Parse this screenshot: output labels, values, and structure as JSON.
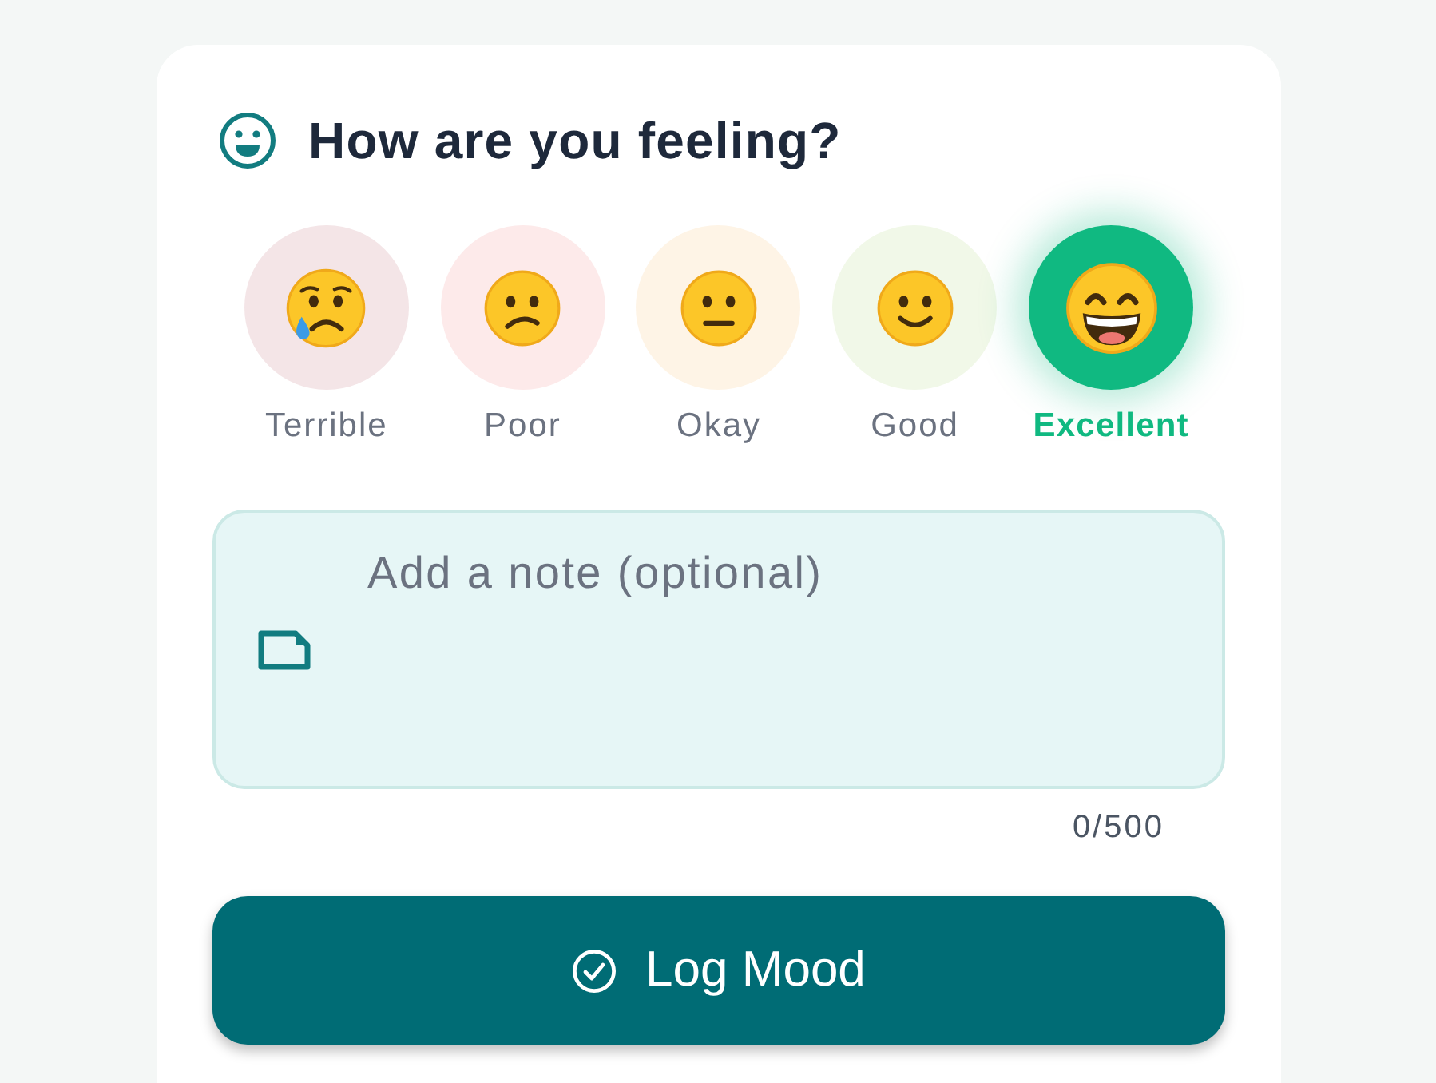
{
  "header": {
    "title": "How are you feeling?"
  },
  "moods": [
    {
      "kind": "terrible",
      "label": "Terrible",
      "color": "#f4e5e7",
      "selected": false
    },
    {
      "kind": "poor",
      "label": "Poor",
      "color": "#fdeaea",
      "selected": false
    },
    {
      "kind": "okay",
      "label": "Okay",
      "color": "#fef4e6",
      "selected": false
    },
    {
      "kind": "good",
      "label": "Good",
      "color": "#f1f8e8",
      "selected": false
    },
    {
      "kind": "excellent",
      "label": "Excellent",
      "color": "#10b981",
      "selected": true
    }
  ],
  "note": {
    "placeholder": "Add a note (optional)",
    "counter": "0/500"
  },
  "submit_button": {
    "label": "Log Mood"
  }
}
